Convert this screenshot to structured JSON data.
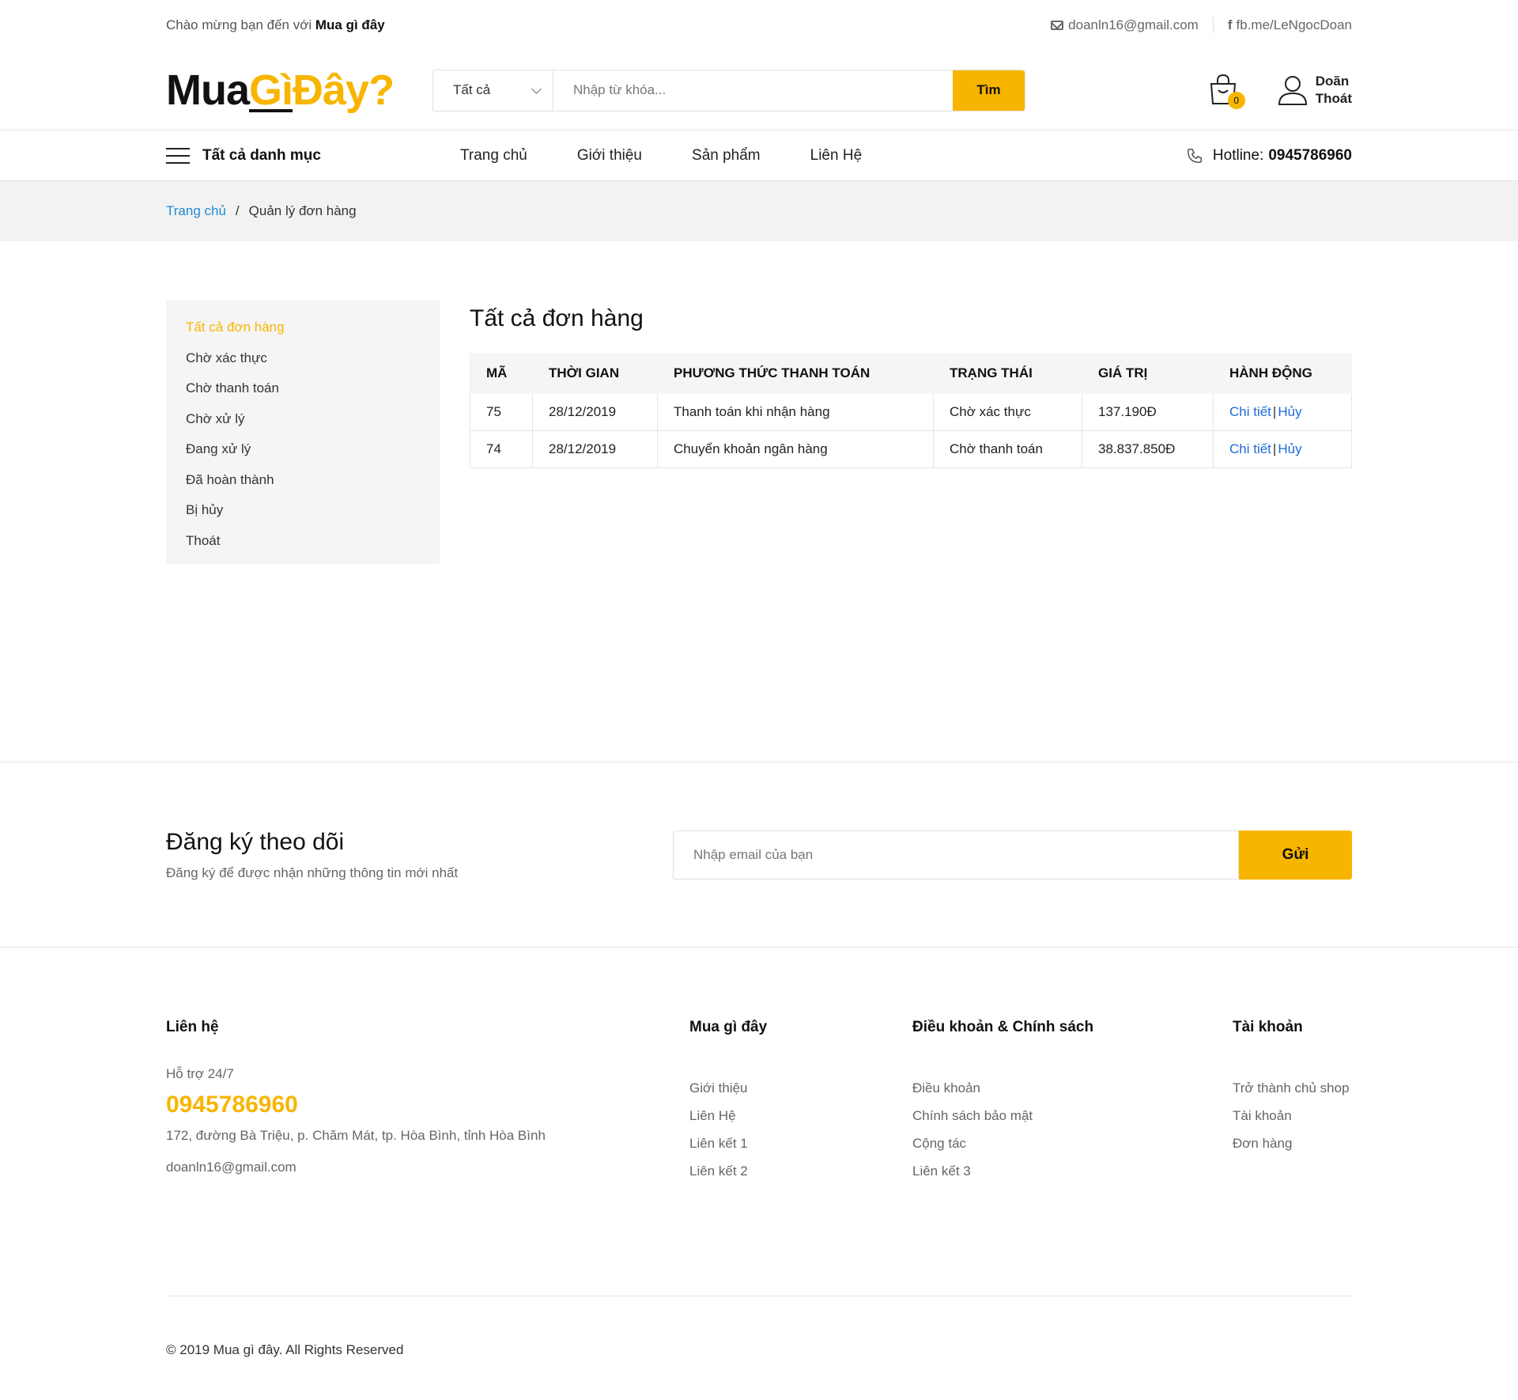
{
  "topbar": {
    "welcome_prefix": "Chào mừng bạn đến với",
    "welcome_brand": "Mua gì đây",
    "email": "doanln16@gmail.com",
    "facebook": "fb.me/LeNgocDoan"
  },
  "header": {
    "logo_part1": "Mua",
    "logo_part2": "Gì",
    "logo_part3": "Đây?",
    "search_category": "Tất cả",
    "search_placeholder": "Nhập từ khóa...",
    "search_button": "Tìm",
    "cart_count": "0",
    "user_name": "Doãn",
    "logout": "Thoát"
  },
  "nav": {
    "all_categories": "Tất cả danh mục",
    "menu": [
      "Trang chủ",
      "Giới thiệu",
      "Sản phẩm",
      "Liên Hệ"
    ],
    "hotline_label": "Hotline:",
    "hotline_number": "0945786960"
  },
  "breadcrumb": {
    "home": "Trang chủ",
    "separator": "/",
    "current": "Quản lý đơn hàng"
  },
  "sidebar": {
    "items": [
      "Tất cả đơn hàng",
      "Chờ xác thực",
      "Chờ thanh toán",
      "Chờ xử lý",
      "Đang xử lý",
      "Đã hoàn thành",
      "Bị hủy",
      "Thoát"
    ]
  },
  "orders": {
    "title": "Tất cả đơn hàng",
    "columns": [
      "MÃ",
      "THỜI GIAN",
      "PHƯƠNG THỨC THANH TOÁN",
      "TRẠNG THÁI",
      "GIÁ TRỊ",
      "HÀNH ĐỘNG"
    ],
    "rows": [
      {
        "id": "75",
        "time": "28/12/2019",
        "payment": "Thanh toán khi nhận hàng",
        "status": "Chờ xác thực",
        "value": "137.190Đ",
        "detail": "Chi tiết",
        "sep": "|",
        "cancel": "Hủy"
      },
      {
        "id": "74",
        "time": "28/12/2019",
        "payment": "Chuyển khoản ngân hàng",
        "status": "Chờ thanh toán",
        "value": "38.837.850Đ",
        "detail": "Chi tiết",
        "sep": "|",
        "cancel": "Hủy"
      }
    ]
  },
  "subscribe": {
    "title": "Đăng ký theo dõi",
    "subtitle": "Đăng ký để được nhận những thông tin mới nhất",
    "placeholder": "Nhập email của bạn",
    "button": "Gửi"
  },
  "footer": {
    "contact": {
      "title": "Liên hệ",
      "support": "Hỗ trợ 24/7",
      "phone": "0945786960",
      "address": "172, đường Bà Triệu, p. Chăm Mát, tp. Hòa Bình, tỉnh Hòa Bình",
      "email": "doanln16@gmail.com"
    },
    "about": {
      "title": "Mua gì đây",
      "links": [
        "Giới thiệu",
        "Liên Hệ",
        "Liên kết 1",
        "Liên kết 2"
      ]
    },
    "policy": {
      "title": "Điều khoản & Chính sách",
      "links": [
        "Điều khoản",
        "Chính sách bảo mật",
        "Cộng tác",
        "Liên kết 3"
      ]
    },
    "account": {
      "title": "Tài khoản",
      "links": [
        "Trở thành chủ shop",
        "Tài khoản",
        "Đơn hàng"
      ]
    },
    "copyright": "© 2019 Mua gì đây. All Rights Reserved"
  },
  "colors": {
    "accent": "#f8b500",
    "link": "#1e8bd8",
    "sidebar_bg": "#f5f5f5"
  }
}
